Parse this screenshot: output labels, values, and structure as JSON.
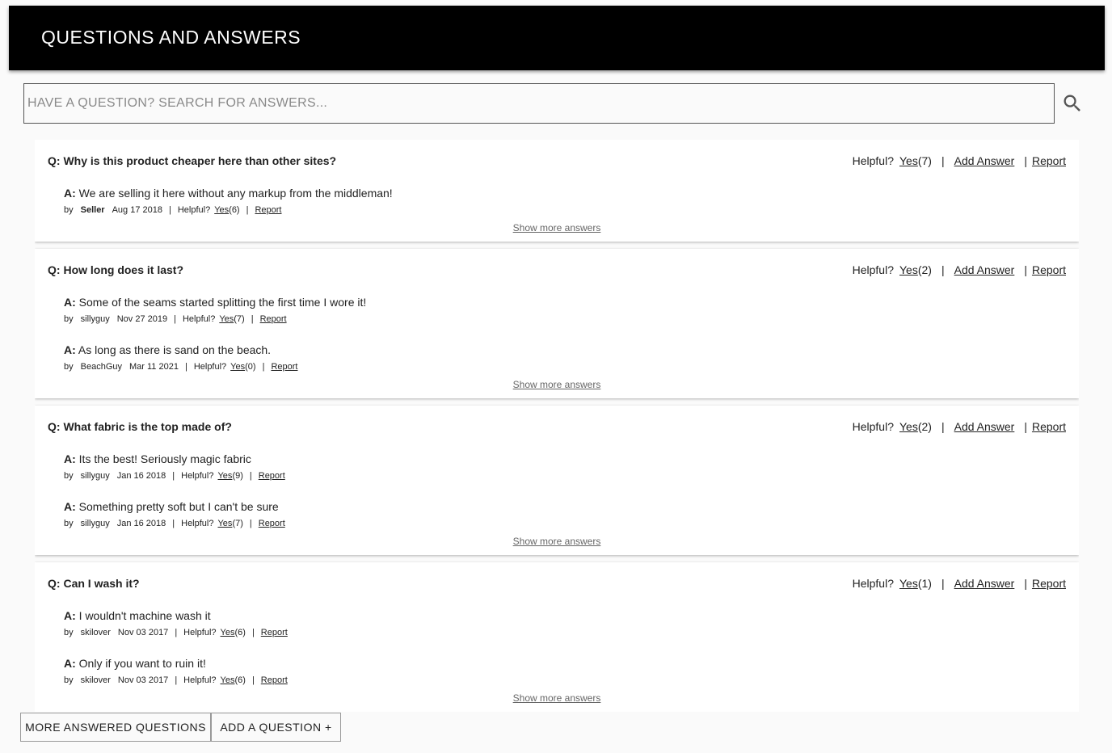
{
  "header": {
    "title": "QUESTIONS AND ANSWERS"
  },
  "search": {
    "placeholder": "HAVE A QUESTION? SEARCH FOR ANSWERS...",
    "icon": "search-icon"
  },
  "labels": {
    "helpful": "Helpful?",
    "yes": "Yes",
    "add_answer": "Add Answer",
    "report": "Report",
    "show_more": "Show more answers",
    "by": "by",
    "q_prefix": "Q:",
    "a_prefix": "A:",
    "pipe": "|"
  },
  "questions": [
    {
      "text": "Why is this product cheaper here than other sites?",
      "helpful_count": "(7)",
      "answers": [
        {
          "text": "We are selling it here without any markup from the middleman!",
          "author": "Seller",
          "seller": true,
          "date": "Aug 17 2018",
          "helpful_count": "(6)"
        }
      ]
    },
    {
      "text": "How long does it last?",
      "helpful_count": "(2)",
      "answers": [
        {
          "text": "Some of the seams started splitting the first time I wore it!",
          "author": "sillyguy",
          "seller": false,
          "date": "Nov 27 2019",
          "helpful_count": "(7)"
        },
        {
          "text": "As long as there is sand on the beach.",
          "author": "BeachGuy",
          "seller": false,
          "date": "Mar 11 2021",
          "helpful_count": "(0)"
        }
      ]
    },
    {
      "text": "What fabric is the top made of?",
      "helpful_count": "(2)",
      "answers": [
        {
          "text": "Its the best! Seriously magic fabric",
          "author": "sillyguy",
          "seller": false,
          "date": "Jan 16 2018",
          "helpful_count": "(9)"
        },
        {
          "text": "Something pretty soft but I can't be sure",
          "author": "sillyguy",
          "seller": false,
          "date": "Jan 16 2018",
          "helpful_count": "(7)"
        }
      ]
    },
    {
      "text": "Can I wash it?",
      "helpful_count": "(1)",
      "answers": [
        {
          "text": "I wouldn't machine wash it",
          "author": "skilover",
          "seller": false,
          "date": "Nov 03 2017",
          "helpful_count": "(6)"
        },
        {
          "text": "Only if you want to ruin it!",
          "author": "skilover",
          "seller": false,
          "date": "Nov 03 2017",
          "helpful_count": "(6)"
        }
      ]
    }
  ],
  "footer": {
    "more_questions": "MORE ANSWERED QUESTIONS",
    "add_question": "ADD A QUESTION +"
  }
}
